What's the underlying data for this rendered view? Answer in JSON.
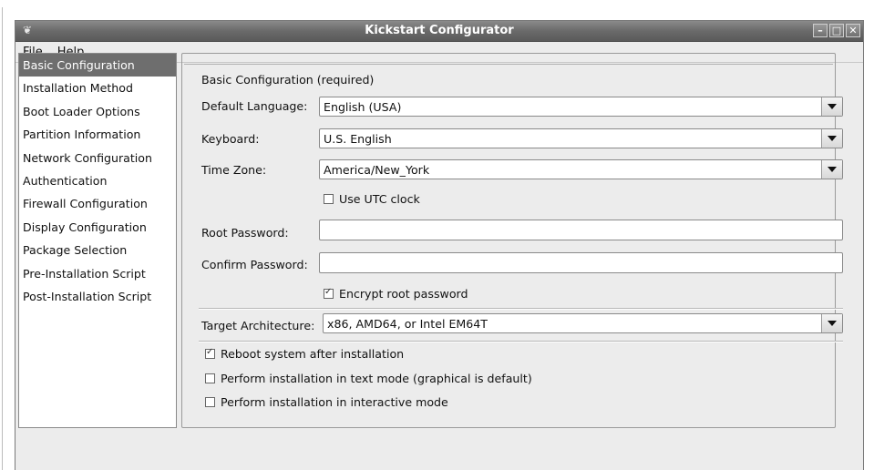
{
  "window": {
    "title": "Kickstart Configurator"
  },
  "menu": {
    "file": "File",
    "help": "Help"
  },
  "sidebar": {
    "items": [
      {
        "label": "Basic Configuration"
      },
      {
        "label": "Installation Method"
      },
      {
        "label": "Boot Loader Options"
      },
      {
        "label": "Partition Information"
      },
      {
        "label": "Network Configuration"
      },
      {
        "label": "Authentication"
      },
      {
        "label": "Firewall Configuration"
      },
      {
        "label": "Display Configuration"
      },
      {
        "label": "Package Selection"
      },
      {
        "label": "Pre-Installation Script"
      },
      {
        "label": "Post-Installation Script"
      }
    ],
    "selected": "Basic Configuration"
  },
  "basic": {
    "group_title": "Basic Configuration (required)",
    "language_label": "Default Language:",
    "language_value": "English (USA)",
    "keyboard_label": "Keyboard:",
    "keyboard_value": "U.S. English",
    "timezone_label": "Time Zone:",
    "timezone_value": "America/New_York",
    "utc_label": "Use UTC clock",
    "utc_checked": false,
    "root_password_label": "Root Password:",
    "root_password_value": "",
    "confirm_password_label": "Confirm Password:",
    "confirm_password_value": "",
    "encrypt_label": "Encrypt root password",
    "encrypt_checked": true,
    "arch_label": "Target Architecture:",
    "arch_value": "x86, AMD64, or Intel EM64T",
    "reboot_label": "Reboot system after installation",
    "reboot_checked": true,
    "textmode_label": "Perform installation in text mode (graphical is default)",
    "textmode_checked": false,
    "interactive_label": "Perform installation in interactive mode",
    "interactive_checked": false
  }
}
